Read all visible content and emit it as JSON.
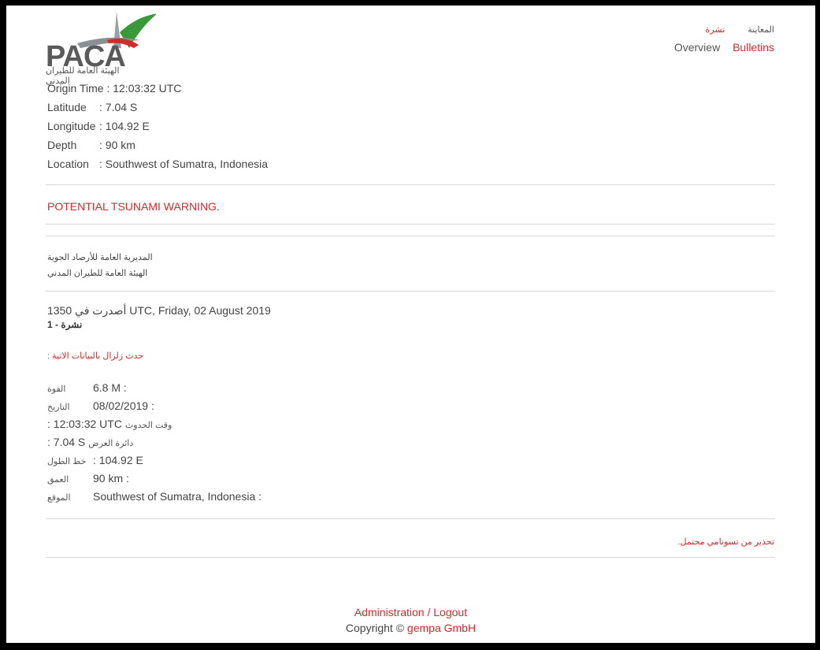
{
  "logo": {
    "text": "PACA",
    "subtitle": "الهيئة العامة للطيران المدني"
  },
  "nav": {
    "ar_bulletins": "نشرة",
    "ar_overview": "المعاينة",
    "overview": "Overview",
    "bulletins": "Bulletins"
  },
  "details_en": [
    {
      "label": "Origin Time",
      "value": ": 12:03:32 UTC"
    },
    {
      "label": "Latitude",
      "value": ": 7.04 S"
    },
    {
      "label": "Longitude",
      "value": ": 104.92 E"
    },
    {
      "label": "Depth",
      "value": ": 90 km"
    },
    {
      "label": "Location",
      "value": ": Southwest of Sumatra, Indonesia"
    }
  ],
  "warning_en": "POTENTIAL TSUNAMI WARNING.",
  "org_ar": {
    "line1": "المديرية العامة للأرصاد الجوية",
    "line2": "الهيئة العامة للطيران المدني"
  },
  "issued": {
    "text": "1350 UTC, Friday, 02 August 2019",
    "prefix_ar": "أصدرت في"
  },
  "bulletin_no": "نشرة - 1",
  "quake_title_ar": ": حدث زلزال بالبيانات الاتية",
  "details_ar": [
    {
      "label": "القوة",
      "value": "6.8 M :"
    },
    {
      "label": "التاريخ",
      "value": "08/02/2019 :"
    },
    {
      "label": "وقت الحدوث",
      "value": ": 12:03:32 UTC"
    },
    {
      "label": "دائرة العرض",
      "value": ": 7.04 S"
    },
    {
      "label": "خط الطول",
      "value": ": 104.92 E"
    },
    {
      "label": "العمق",
      "value": "90 km :"
    },
    {
      "label": "الموقع",
      "value": "Southwest of Sumatra, Indonesia :"
    }
  ],
  "warning_ar": ".تحذير من تسونامي محتمل",
  "footer": {
    "admin": "Administration",
    "sep": " / ",
    "logout": "Logout",
    "copyright": "Copyright © ",
    "company": "gempa GmbH"
  },
  "colors": {
    "accent": "#e0262a",
    "text": "#444444",
    "rule": "#d8d8d8"
  }
}
